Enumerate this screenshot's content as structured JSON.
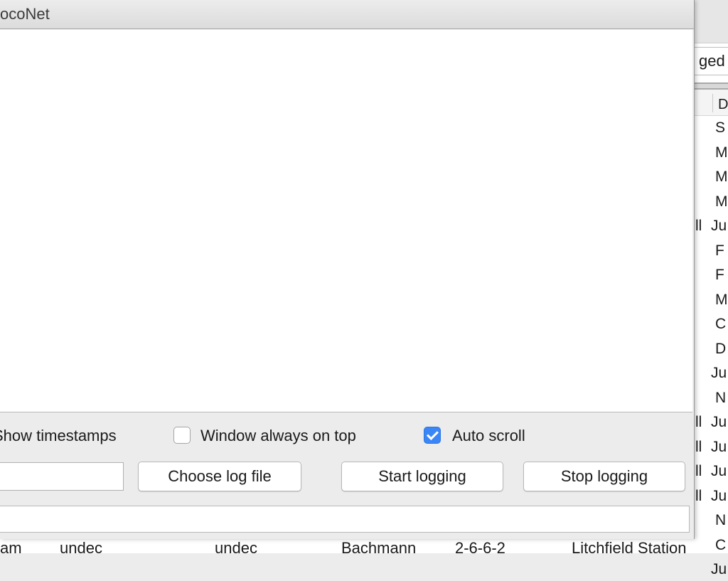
{
  "dialog": {
    "title": "ocoNet"
  },
  "options": {
    "show_timestamps_label": "Show timestamps",
    "show_timestamps_checked": false,
    "always_on_top_label": "Window always on top",
    "always_on_top_checked": false,
    "auto_scroll_label": "Auto scroll",
    "auto_scroll_checked": true
  },
  "buttons": {
    "choose_log_file": "Choose log file",
    "start_logging": "Start logging",
    "stop_logging": "Stop logging"
  },
  "background": {
    "field_text": "ged",
    "column_header": "D",
    "column_cells": [
      "S",
      "M",
      "M",
      "M",
      "Ju",
      "F",
      "F",
      "M",
      "C",
      "D",
      "Ju",
      "N",
      "Ju",
      "Ju",
      "Ju",
      "Ju",
      "N",
      "C",
      "Ju"
    ],
    "left_cells": [
      "ll",
      "ll",
      "ll",
      "ll",
      "ll"
    ],
    "bottom_row": [
      "am",
      "undec",
      "undec",
      "Bachmann",
      "2-6-6-2",
      "Litchfield Station"
    ]
  },
  "colors": {
    "accent": "#3b86f7",
    "dialog_bg": "#ececec",
    "monitor_bg": "#ffffff"
  }
}
